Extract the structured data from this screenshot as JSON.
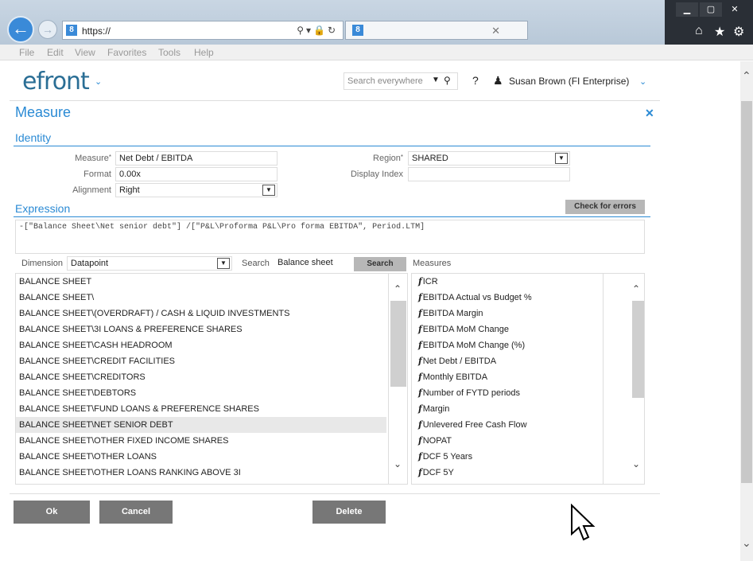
{
  "browser": {
    "url": "https://",
    "menu": [
      "File",
      "Edit",
      "View",
      "Favorites",
      "Tools",
      "Help"
    ],
    "window_buttons": [
      "▁",
      "▢",
      "✕"
    ],
    "toolbar_icons": [
      "home-icon",
      "star-icon",
      "gear-icon"
    ]
  },
  "app": {
    "logo": "efront",
    "search_placeholder": "Search everywhere",
    "user_name": "Susan Brown (FI Enterprise)"
  },
  "dialog": {
    "title": "Measure",
    "identity": {
      "heading": "Identity",
      "measure_label": "Measure",
      "measure_value": "Net Debt / EBITDA",
      "format_label": "Format",
      "format_value": "0.00x",
      "alignment_label": "Alignment",
      "alignment_value": "Right",
      "region_label": "Region",
      "region_value": "SHARED",
      "display_index_label": "Display Index",
      "display_index_value": ""
    },
    "expression": {
      "heading": "Expression",
      "check_label": "Check for errors",
      "text": "-[\"Balance Sheet\\Net senior debt\"] /[\"P&L\\Proforma P&L\\Pro forma EBITDA\", Period.LTM]"
    },
    "dimension": {
      "label": "Dimension",
      "value": "Datapoint",
      "search_label": "Search",
      "search_value": "Balance sheet",
      "search_button": "Search",
      "measures_label": "Measures"
    },
    "datapoints": [
      "BALANCE SHEET",
      "BALANCE SHEET\\",
      "BALANCE SHEET\\(OVERDRAFT) / CASH & LIQUID INVESTMENTS",
      "BALANCE SHEET\\3I LOANS & PREFERENCE SHARES",
      "BALANCE SHEET\\CASH HEADROOM",
      "BALANCE SHEET\\CREDIT FACILITIES",
      "BALANCE SHEET\\CREDITORS",
      "BALANCE SHEET\\DEBTORS",
      "BALANCE SHEET\\FUND LOANS & PREFERENCE SHARES",
      "BALANCE SHEET\\NET SENIOR DEBT",
      "BALANCE SHEET\\OTHER FIXED INCOME SHARES",
      "BALANCE SHEET\\OTHER LOANS",
      "BALANCE SHEET\\OTHER LOANS RANKING ABOVE 3I"
    ],
    "measures": [
      "ICR",
      "EBITDA Actual vs Budget %",
      "EBITDA Margin",
      "EBITDA MoM Change",
      "EBITDA MoM Change (%)",
      "Net Debt / EBITDA",
      "Monthly EBITDA",
      "Number of FYTD periods",
      "Margin",
      "Unlevered Free Cash Flow",
      "NOPAT",
      "DCF 5 Years",
      "DCF 5Y"
    ],
    "buttons": {
      "ok": "Ok",
      "cancel": "Cancel",
      "delete": "Delete"
    }
  }
}
